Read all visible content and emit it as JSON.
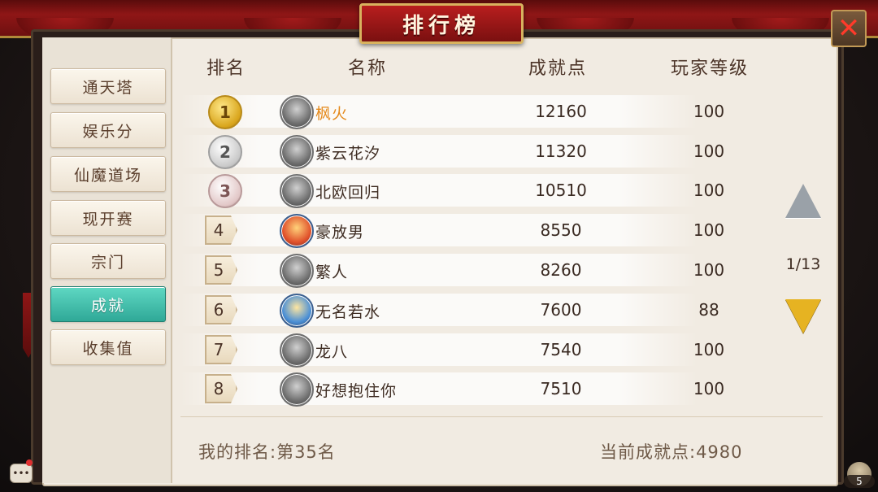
{
  "title": "排行榜",
  "close_icon": "close-icon",
  "sidebar": {
    "items": [
      {
        "label": "通天塔",
        "active": false
      },
      {
        "label": "娱乐分",
        "active": false
      },
      {
        "label": "仙魔道场",
        "active": false
      },
      {
        "label": "现开赛",
        "active": false
      },
      {
        "label": "宗门",
        "active": false
      },
      {
        "label": "成就",
        "active": true
      },
      {
        "label": "收集值",
        "active": false
      }
    ]
  },
  "table": {
    "headers": {
      "rank": "排名",
      "name": "名称",
      "points": "成就点",
      "level": "玩家等级"
    },
    "rows": [
      {
        "rank": "1",
        "name": "枫火",
        "points": "12160",
        "level": "100"
      },
      {
        "rank": "2",
        "name": "紫云花汐",
        "points": "11320",
        "level": "100"
      },
      {
        "rank": "3",
        "name": "北欧回归",
        "points": "10510",
        "level": "100"
      },
      {
        "rank": "4",
        "name": "豪放男",
        "points": "8550",
        "level": "100"
      },
      {
        "rank": "5",
        "name": "繁人",
        "points": "8260",
        "level": "100"
      },
      {
        "rank": "6",
        "name": "无名若水",
        "points": "7600",
        "level": "88"
      },
      {
        "rank": "7",
        "name": "龙八",
        "points": "7540",
        "level": "100"
      },
      {
        "rank": "8",
        "name": "好想抱住你",
        "points": "7510",
        "level": "100"
      }
    ]
  },
  "pagination": {
    "page": "1/13"
  },
  "footer": {
    "my_rank": "我的排名:第35名",
    "current_points": "当前成就点:4980"
  },
  "bottom": {
    "online_count": "5"
  },
  "colors": {
    "accent_active": "#2fa897",
    "first_place_name": "#e58a1c",
    "arrow_down": "#e6b322"
  }
}
